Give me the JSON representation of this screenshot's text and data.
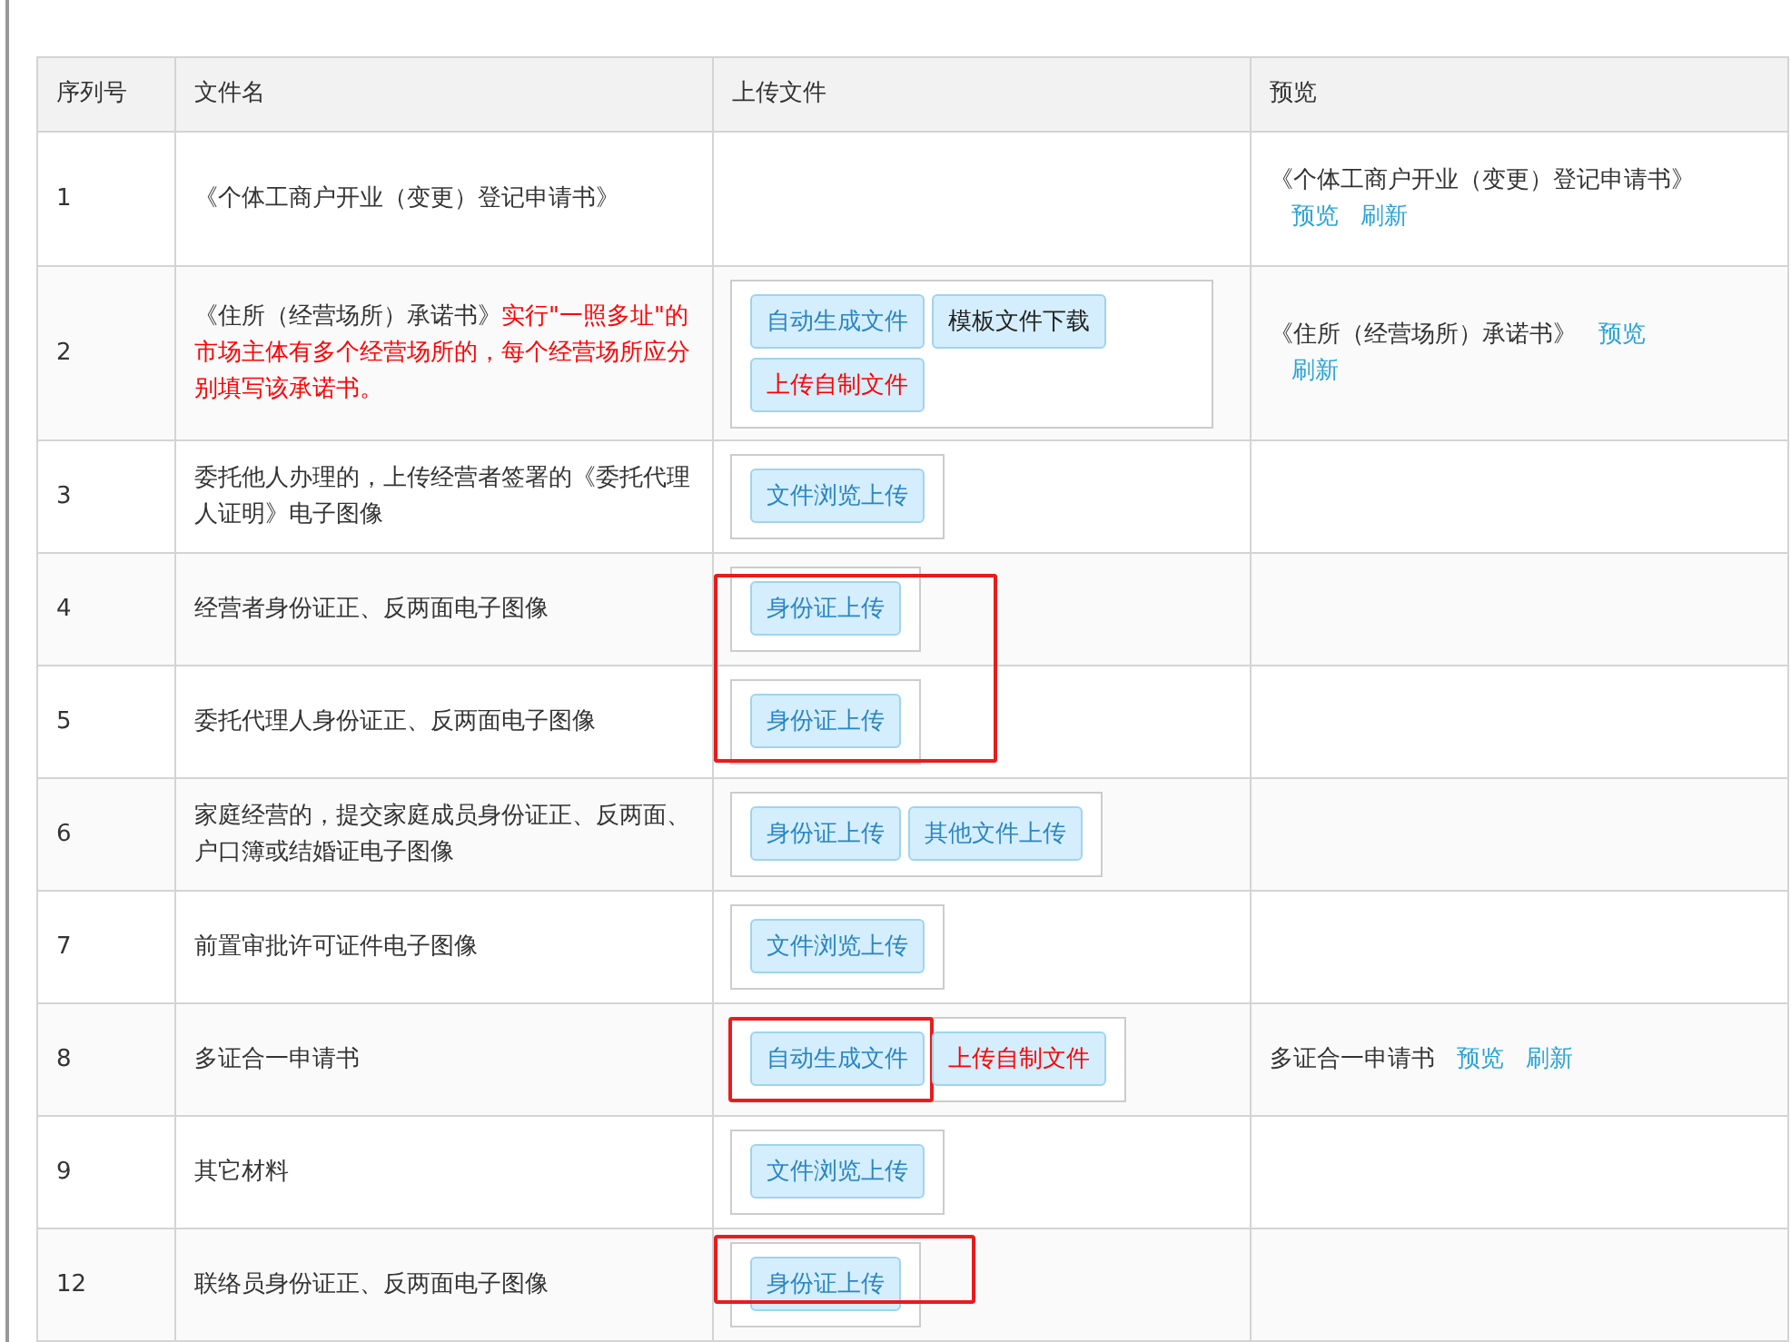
{
  "table": {
    "columns": [
      "序列号",
      "文件名",
      "上传文件",
      "预览"
    ],
    "rows": [
      {
        "index": "1",
        "name": "《个体工商户开业（变更）登记申请书》",
        "highlighted": false,
        "buttons": [],
        "preview": {
          "text": "《个体工商户开业（变更）登记申请书》",
          "links": [
            "预览",
            "刷新"
          ]
        }
      },
      {
        "index": "2",
        "name": "《住所（经营场所）承诺书》",
        "note": "实行\"一照多址\"的市场主体有多个经营场所的，每个经营场所应分别填写该承诺书。",
        "highlighted": false,
        "buttons": [
          {
            "label": "自动生成文件",
            "kind": "blue",
            "highlighted": false
          },
          {
            "label": "模板文件下载",
            "kind": "dark",
            "highlighted": false
          },
          {
            "label": "上传自制文件",
            "kind": "red",
            "highlighted": false
          }
        ],
        "preview": {
          "text": "《住所（经营场所）承诺书》",
          "links": [
            "预览",
            "刷新"
          ]
        }
      },
      {
        "index": "3",
        "name": "委托他人办理的，上传经营者签署的《委托代理人证明》电子图像",
        "highlighted": false,
        "buttons": [
          {
            "label": "文件浏览上传",
            "kind": "blue",
            "highlighted": false
          }
        ]
      },
      {
        "index": "4",
        "name": "经营者身份证正、反两面电子图像",
        "highlighted": true,
        "buttons": [
          {
            "label": "身份证上传",
            "kind": "blue",
            "highlighted": false
          }
        ]
      },
      {
        "index": "5",
        "name": "委托代理人身份证正、反两面电子图像",
        "highlighted": true,
        "buttons": [
          {
            "label": "身份证上传",
            "kind": "blue",
            "highlighted": false
          }
        ]
      },
      {
        "index": "6",
        "name": "家庭经营的，提交家庭成员身份证正、反两面、户口簿或结婚证电子图像",
        "highlighted": false,
        "buttons": [
          {
            "label": "身份证上传",
            "kind": "blue",
            "highlighted": false
          },
          {
            "label": "其他文件上传",
            "kind": "blue",
            "highlighted": false
          }
        ]
      },
      {
        "index": "7",
        "name": "前置审批许可证件电子图像",
        "highlighted": false,
        "buttons": [
          {
            "label": "文件浏览上传",
            "kind": "blue",
            "highlighted": false
          }
        ]
      },
      {
        "index": "8",
        "name": "多证合一申请书",
        "highlighted": false,
        "buttons": [
          {
            "label": "自动生成文件",
            "kind": "blue",
            "highlighted": true
          },
          {
            "label": "上传自制文件",
            "kind": "red",
            "highlighted": false
          }
        ],
        "preview": {
          "text": "多证合一申请书",
          "links": [
            "预览",
            "刷新"
          ]
        }
      },
      {
        "index": "9",
        "name": "其它材料",
        "highlighted": false,
        "buttons": [
          {
            "label": "文件浏览上传",
            "kind": "blue",
            "highlighted": false
          }
        ]
      },
      {
        "index": "12",
        "name": "联络员身份证正、反两面电子图像",
        "highlighted": true,
        "buttons": [
          {
            "label": "身份证上传",
            "kind": "blue",
            "highlighted": false
          }
        ]
      }
    ]
  }
}
